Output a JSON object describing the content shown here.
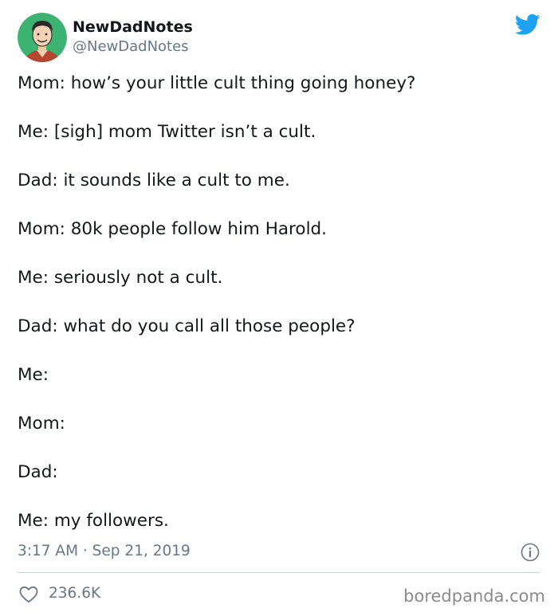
{
  "colors": {
    "twitter_blue": "#1da1f2",
    "avatar_background": "#3cb371",
    "text_primary": "#14171a",
    "text_secondary": "#657786",
    "divider": "#ccd6dd",
    "watermark": "#8a8a8a"
  },
  "author": {
    "name": "NewDadNotes",
    "handle": "@NewDadNotes",
    "avatar_icon": "cartoon-man-avatar"
  },
  "header": {
    "logo_icon": "twitter-bird-icon"
  },
  "tweet": {
    "lines": [
      "Mom: how’s your little cult thing going honey?",
      "Me: [sigh] mom Twitter isn’t a cult.",
      "Dad: it sounds like a cult to me.",
      "Mom: 80k people follow him Harold.",
      "Me: seriously not a cult.",
      "Dad: what do you call all those people?",
      "Me:",
      "Mom:",
      "Dad:",
      "Me: my followers."
    ],
    "timestamp": "3:17 AM · Sep 21, 2019",
    "info_icon": "info-icon"
  },
  "engagement": {
    "like_icon": "heart-icon",
    "likes": "236.6K"
  },
  "watermark": {
    "text": "boredpanda.com"
  }
}
